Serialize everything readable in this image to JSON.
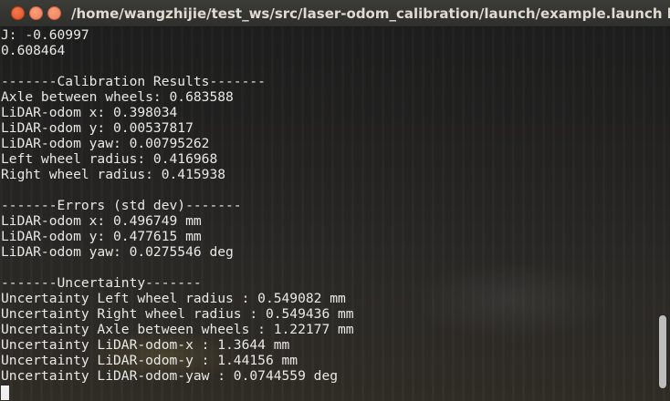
{
  "window": {
    "title": "/home/wangzhijie/test_ws/src/laser-odom_calibration/launch/example.launch http://loc"
  },
  "terminal": {
    "lines": [
      "J: -0.60997",
      "0.608464",
      "",
      "-------Calibration Results-------",
      "Axle between wheels: 0.683588",
      "LiDAR-odom x: 0.398034",
      "LiDAR-odom y: 0.00537817",
      "LiDAR-odom yaw: 0.00795262",
      "Left wheel radius: 0.416968",
      "Right wheel radius: 0.415938",
      "",
      "-------Errors (std dev)-------",
      "LiDAR-odom x: 0.496749 mm",
      "LiDAR-odom y: 0.477615 mm",
      "LiDAR-odom yaw: 0.0275546 deg",
      "",
      "-------Uncertainty-------",
      "Uncertainty Left wheel radius : 0.549082 mm",
      "Uncertainty Right wheel radius : 0.549436 mm",
      "Uncertainty Axle between wheels : 1.22177 mm",
      "Uncertainty LiDAR-odom-x : 1.3644 mm",
      "Uncertainty LiDAR-odom-y : 1.44156 mm",
      "Uncertainty LiDAR-odom-yaw : 0.0744559 deg"
    ]
  },
  "icons": {
    "close": "close-icon",
    "minimize": "minimize-icon",
    "maximize": "maximize-icon"
  },
  "colors": {
    "close": "#e0501d",
    "minimize": "#ef7d56",
    "maximize": "#ef7d56",
    "text": "#e9e9e6",
    "titlebar": "#2f2f2c"
  }
}
